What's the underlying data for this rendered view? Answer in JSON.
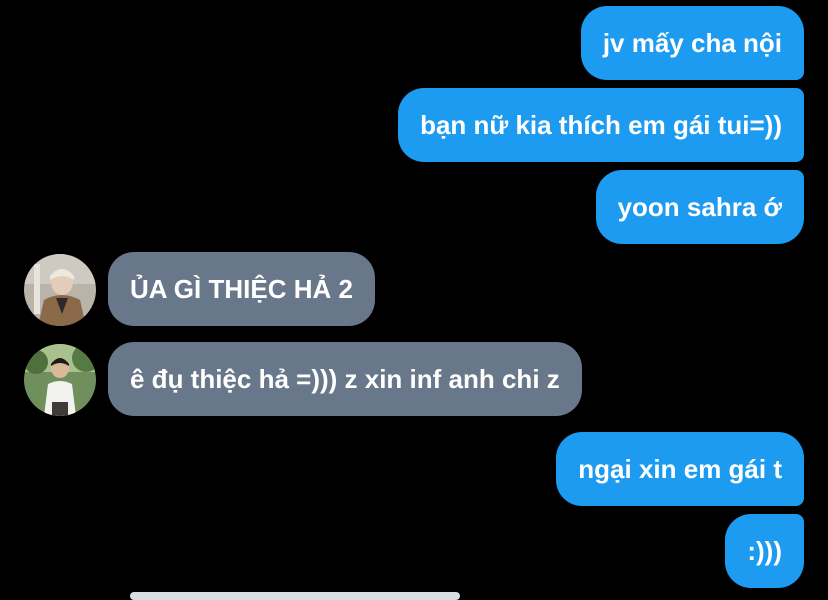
{
  "conversation": {
    "messages": [
      {
        "direction": "sent",
        "text": "jv mấy cha nội"
      },
      {
        "direction": "sent",
        "text": "bạn nữ kia thích em gái tui=))"
      },
      {
        "direction": "sent",
        "text": "yoon sahra ớ"
      },
      {
        "direction": "received",
        "text": "ỦA GÌ THIỆC HẢ 2"
      },
      {
        "direction": "received",
        "text": "ê đụ thiệc hả =))) z xin inf anh chi z"
      },
      {
        "direction": "sent",
        "text": "ngại xin em gái t"
      },
      {
        "direction": "sent",
        "text": ":)))"
      }
    ]
  },
  "colors": {
    "background": "#000000",
    "sent_bubble": "#1d9bf0",
    "received_bubble": "#687789",
    "text": "#ffffff"
  }
}
